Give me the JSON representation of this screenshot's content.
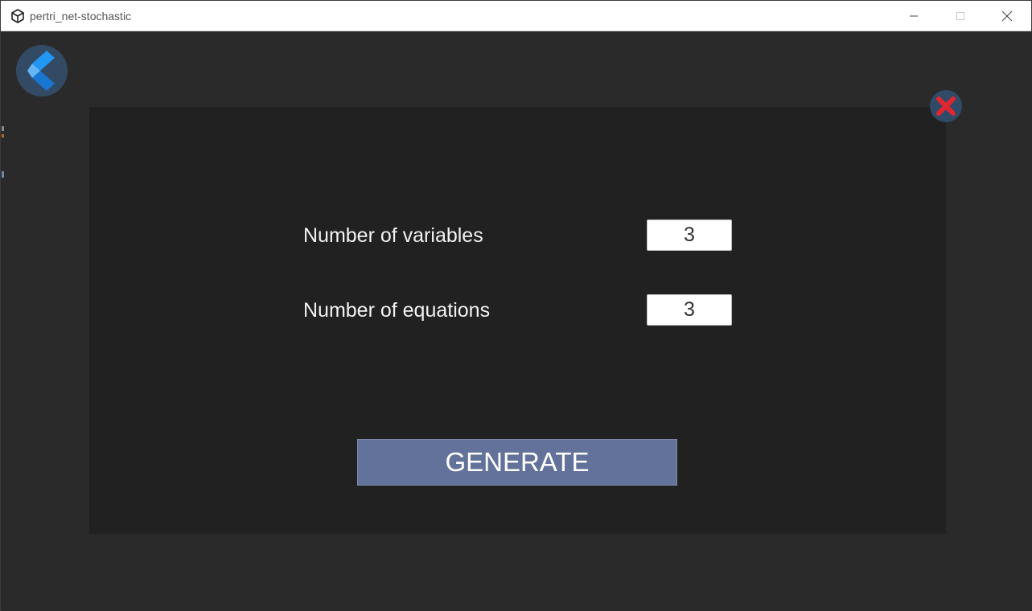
{
  "window": {
    "title": "pertri_net-stochastic",
    "app_icon": "unity-logo-icon",
    "controls": [
      "minimize-icon",
      "maximize-icon",
      "close-icon"
    ]
  },
  "toolbar": {
    "back_icon": "chevron-left-icon",
    "close_icon": "red-x-icon"
  },
  "form": {
    "variables_label": "Number of variables",
    "variables_value": "3",
    "equations_label": "Number of equations",
    "equations_value": "3",
    "generate_label": "GENERATE"
  },
  "colors": {
    "background": "#2a2a2a",
    "panel": "#212121",
    "button": "#63729a",
    "back_circle": "#334a64",
    "back_chevron": "#2196f3",
    "close_x": "#e0262e"
  }
}
